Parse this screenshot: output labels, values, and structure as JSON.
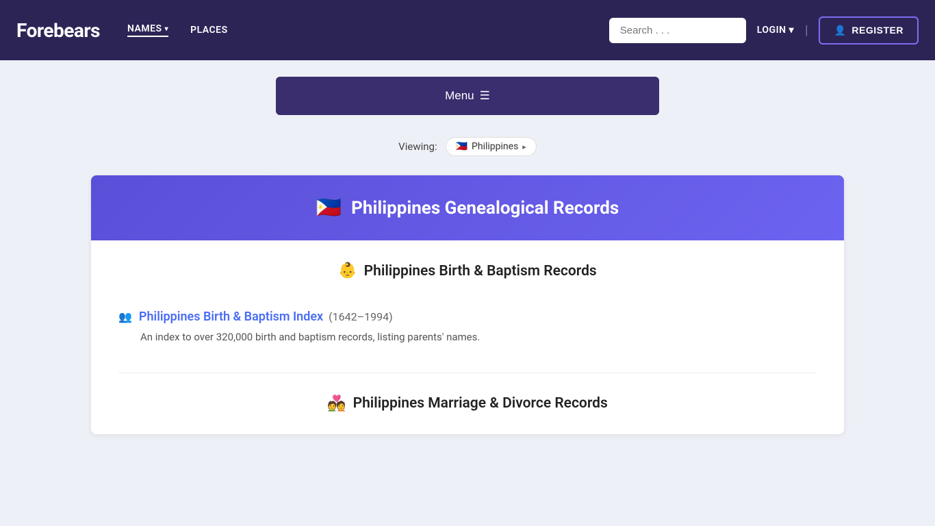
{
  "nav": {
    "logo": "Forebears",
    "links": [
      {
        "id": "names",
        "label": "NAMES",
        "has_dropdown": true,
        "underlined": true
      },
      {
        "id": "places",
        "label": "PLACES",
        "has_dropdown": false,
        "underlined": false
      }
    ],
    "search_placeholder": "Search . . .",
    "login_label": "LOGIN",
    "register_label": "REGISTER",
    "register_icon": "👤"
  },
  "menu_button": {
    "label": "Menu",
    "icon": "☰"
  },
  "viewing": {
    "label": "Viewing:",
    "country": "Philippines",
    "flag": "🇵🇭"
  },
  "card": {
    "header": {
      "flag": "🇵🇭",
      "title": "Philippines Genealogical Records"
    },
    "sections": [
      {
        "id": "birth-baptism",
        "header_icon": "👶",
        "header_title": "Philippines Birth & Baptism Records",
        "records": [
          {
            "id": "birth-baptism-index",
            "icon": "👥",
            "title": "Philippines Birth & Baptism Index",
            "date_range": "(1642–1994)",
            "description": "An index to over 320,000 birth and baptism records, listing parents' names."
          }
        ]
      },
      {
        "id": "marriage-divorce",
        "header_icon": "💑",
        "header_title": "Philippines Marriage & Divorce Records",
        "records": []
      }
    ]
  }
}
